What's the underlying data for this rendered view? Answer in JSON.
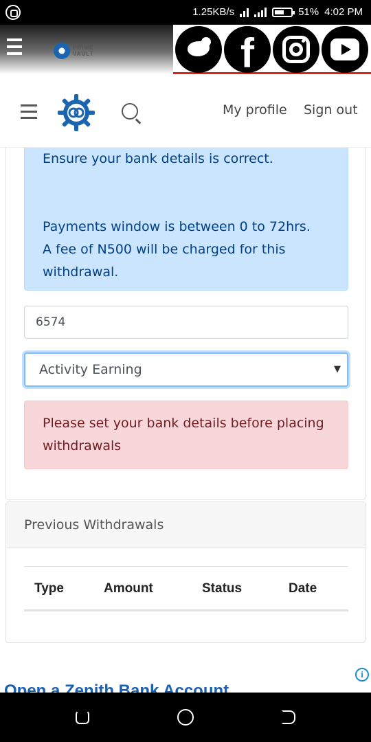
{
  "status_bar": {
    "network_speed": "1.25KB/s",
    "battery": "51%",
    "time": "4:02 PM"
  },
  "ad_banner": {
    "logo_line1": "PRIME",
    "logo_line2": "VAULT",
    "social_icons": [
      "twitter-icon",
      "facebook-icon",
      "instagram-icon",
      "youtube-icon"
    ],
    "facebook_glyph": "f"
  },
  "header": {
    "my_profile": "My profile",
    "sign_out": "Sign out"
  },
  "withdraw_form": {
    "info_line1": "Ensure your bank details is correct.",
    "info_line2": "Payments window is between 0 to 72hrs.",
    "info_line3": "A fee of N500 will be charged for this withdrawal.",
    "amount_value": "6574",
    "source_selected": "Activity Earning",
    "error_message": "Please set your bank details before placing withdrawals"
  },
  "previous_withdrawals": {
    "title": "Previous Withdrawals",
    "columns": [
      "Type",
      "Amount",
      "Status",
      "Date"
    ]
  },
  "bottom_ad": {
    "text": "Open a Zenith Bank Account",
    "info_glyph": "i"
  },
  "colors": {
    "info_bg": "#cce5ff",
    "info_text": "#004085",
    "danger_bg": "#f8d7da",
    "danger_text": "#721c24",
    "brand_blue": "#1a64b0"
  }
}
